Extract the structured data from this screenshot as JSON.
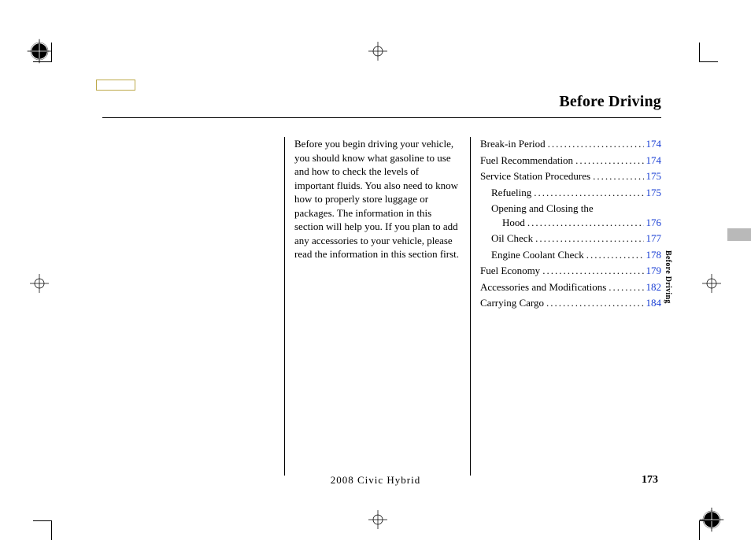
{
  "header": {
    "title": "Before Driving"
  },
  "intro": "Before you begin driving your vehicle, you should know what gasoline to use and how to check the levels of important fluids. You also need to know how to properly store luggage or packages. The information in this section will help you. If you plan to add any accessories to your vehicle, please read the information in this section first.",
  "toc": [
    {
      "label": "Break-in Period",
      "page": "174",
      "indent": 0
    },
    {
      "label": "Fuel Recommendation",
      "page": "174",
      "indent": 0
    },
    {
      "label": "Service Station Procedures",
      "page": "175",
      "indent": 0
    },
    {
      "label": "Refueling",
      "page": "175",
      "indent": 1
    },
    {
      "label": "Opening and Closing the",
      "page": "",
      "indent": 1,
      "nowrapPage": true
    },
    {
      "label": "Hood",
      "page": "176",
      "indent": 2
    },
    {
      "label": "Oil Check",
      "page": "177",
      "indent": 1
    },
    {
      "label": "Engine Coolant Check",
      "page": "178",
      "indent": 1
    },
    {
      "label": "Fuel Economy",
      "page": "179",
      "indent": 0
    },
    {
      "label": "Accessories and Modifications",
      "page": "182",
      "indent": 0
    },
    {
      "label": "Carrying Cargo",
      "page": "184",
      "indent": 0
    }
  ],
  "footer": {
    "model": "2008  Civic  Hybrid",
    "pageNumber": "173"
  },
  "sideTab": "Before Driving"
}
